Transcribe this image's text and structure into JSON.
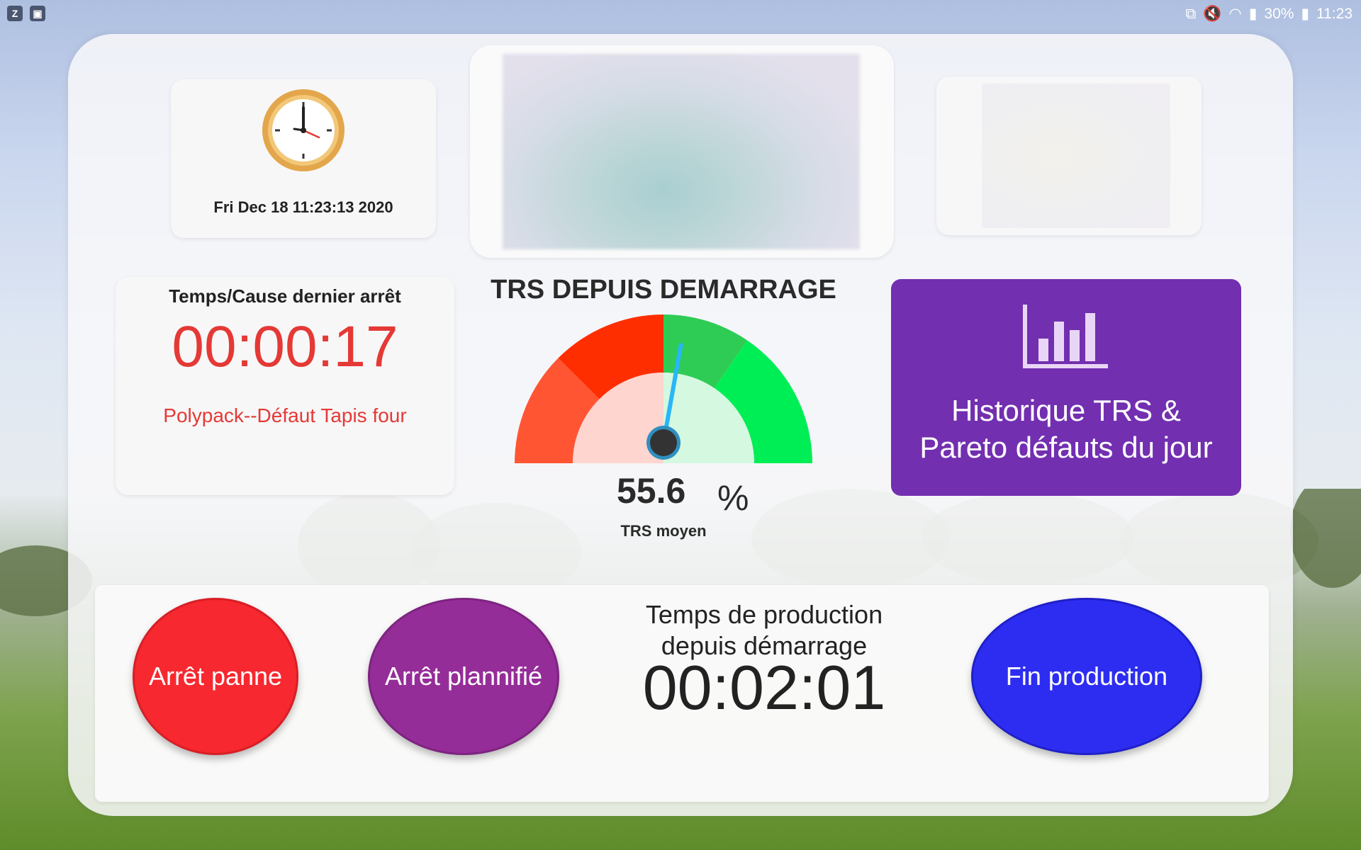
{
  "status_bar": {
    "left_icons": [
      "z-app-icon",
      "gallery-app-icon"
    ],
    "battery": "30%",
    "time": "11:23"
  },
  "clock_card": {
    "datetime": "Fri Dec 18 11:23:13 2020"
  },
  "last_stop": {
    "title": "Temps/Cause dernier arrêt",
    "duration": "00:00:17",
    "cause": "Polypack--Défaut Tapis four"
  },
  "gauge": {
    "title": "TRS DEPUIS DEMARRAGE",
    "value": "55.6",
    "unit": "%",
    "subtitle": "TRS moyen",
    "value_fraction": 0.556,
    "colors": {
      "red": "#ff2e00",
      "red_light": "#ff5533",
      "green": "#00ee55",
      "green_dark": "#2ecc55",
      "needle": "#29b6f6"
    }
  },
  "history_button": {
    "label_line1": "Historique TRS &",
    "label_line2": "Pareto défauts du jour",
    "color": "#722fb0"
  },
  "controls": {
    "panne_label": "Arrêt panne",
    "planifie_label": "Arrêt plannifié",
    "fin_label": "Fin production",
    "production_label_line1": "Temps de production",
    "production_label_line2": "depuis démarrage",
    "production_time": "00:02:01"
  }
}
